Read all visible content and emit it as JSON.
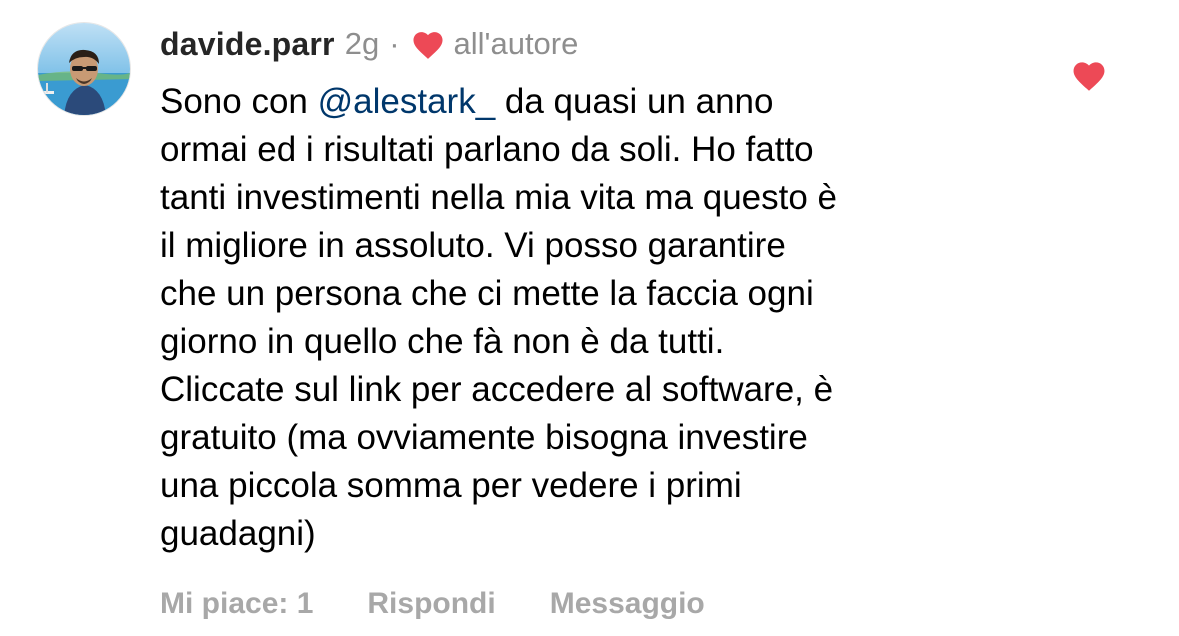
{
  "comment": {
    "username": "davide.parr",
    "time": "2g",
    "separator": "·",
    "author_like_label": "all'autore",
    "body": {
      "line1_pre": "Sono con ",
      "mention": "@alestark_",
      "line1_post": " da quasi un anno",
      "lines": [
        "ormai ed i risultati parlano da soli. Ho fatto",
        "tanti investimenti nella mia vita ma questo è",
        "il migliore in assoluto. Vi posso garantire",
        "che un persona che ci mette la faccia ogni",
        "giorno in quello che fà non è da tutti.",
        "Cliccate sul link per accedere al software, è",
        "gratuito (ma ovviamente bisogna investire",
        "una piccola somma per vedere i primi",
        "guadagni)"
      ]
    },
    "actions": {
      "likes": "Mi piace: 1",
      "reply": "Rispondi",
      "message": "Messaggio"
    },
    "liked": true
  },
  "colors": {
    "heart": "#ed4956",
    "mention": "#00376b",
    "secondary_text": "#8e8e8e",
    "action_text": "#a8a8a8"
  },
  "icons": {
    "author_heart": "heart-filled-icon",
    "like_button": "heart-filled-icon"
  }
}
